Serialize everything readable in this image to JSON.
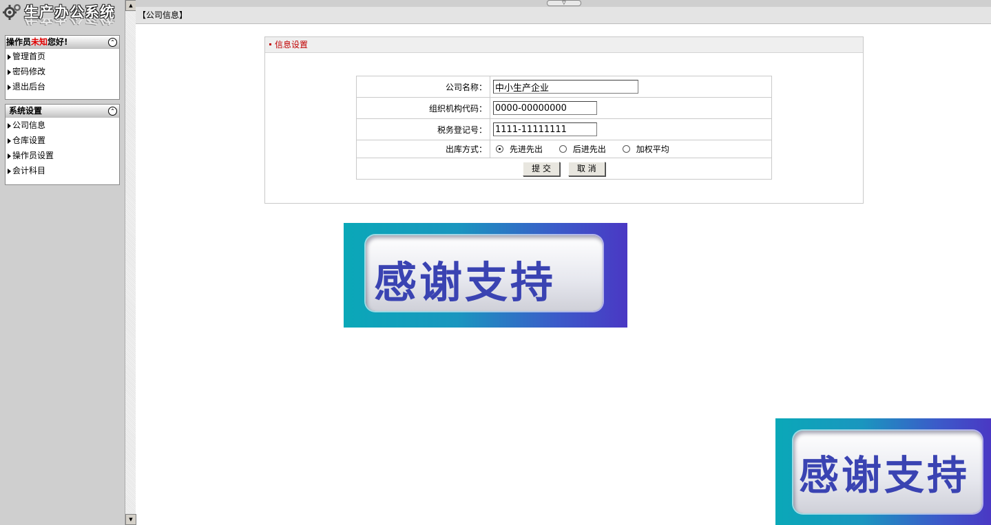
{
  "app": {
    "title": "生产办公系统",
    "title_reflection": "生产办公系统"
  },
  "sidebar": {
    "user_box": {
      "greeting_prefix": "操作员",
      "username": "未知",
      "greeting_suffix": "您好!",
      "items": [
        {
          "label": "管理首页"
        },
        {
          "label": "密码修改"
        },
        {
          "label": "退出后台"
        }
      ]
    },
    "settings_box": {
      "title": "系统设置",
      "items": [
        {
          "label": "公司信息"
        },
        {
          "label": "仓库设置"
        },
        {
          "label": "操作员设置"
        },
        {
          "label": "会计科目"
        }
      ]
    }
  },
  "breadcrumb": "【公司信息】",
  "panel": {
    "title": "信息设置",
    "form": {
      "company_name": {
        "label": "公司名称：",
        "value": "中小生产企业"
      },
      "org_code": {
        "label": "组织机构代码：",
        "value": "0000-00000000"
      },
      "tax_reg": {
        "label": "税务登记号：",
        "value": "1111-11111111"
      },
      "outbound": {
        "label": "出库方式：",
        "options": [
          {
            "label": "先进先出",
            "selected": true
          },
          {
            "label": "后进先出",
            "selected": false
          },
          {
            "label": "加权平均",
            "selected": false
          }
        ]
      },
      "submit_label": "提 交",
      "cancel_label": "取 消"
    }
  },
  "banners": {
    "text_1": "感谢支持",
    "text_2": "感谢支持"
  },
  "colors": {
    "accent_red": "#c00000",
    "username_red": "#e00000",
    "banner_text": "#3a43b2"
  },
  "icons": {
    "logo": "gear-icon",
    "collapse": "chevron-up-icon",
    "menu_bullet": "triangle-right-icon",
    "frame_toggle": "chevron-down-icon"
  }
}
